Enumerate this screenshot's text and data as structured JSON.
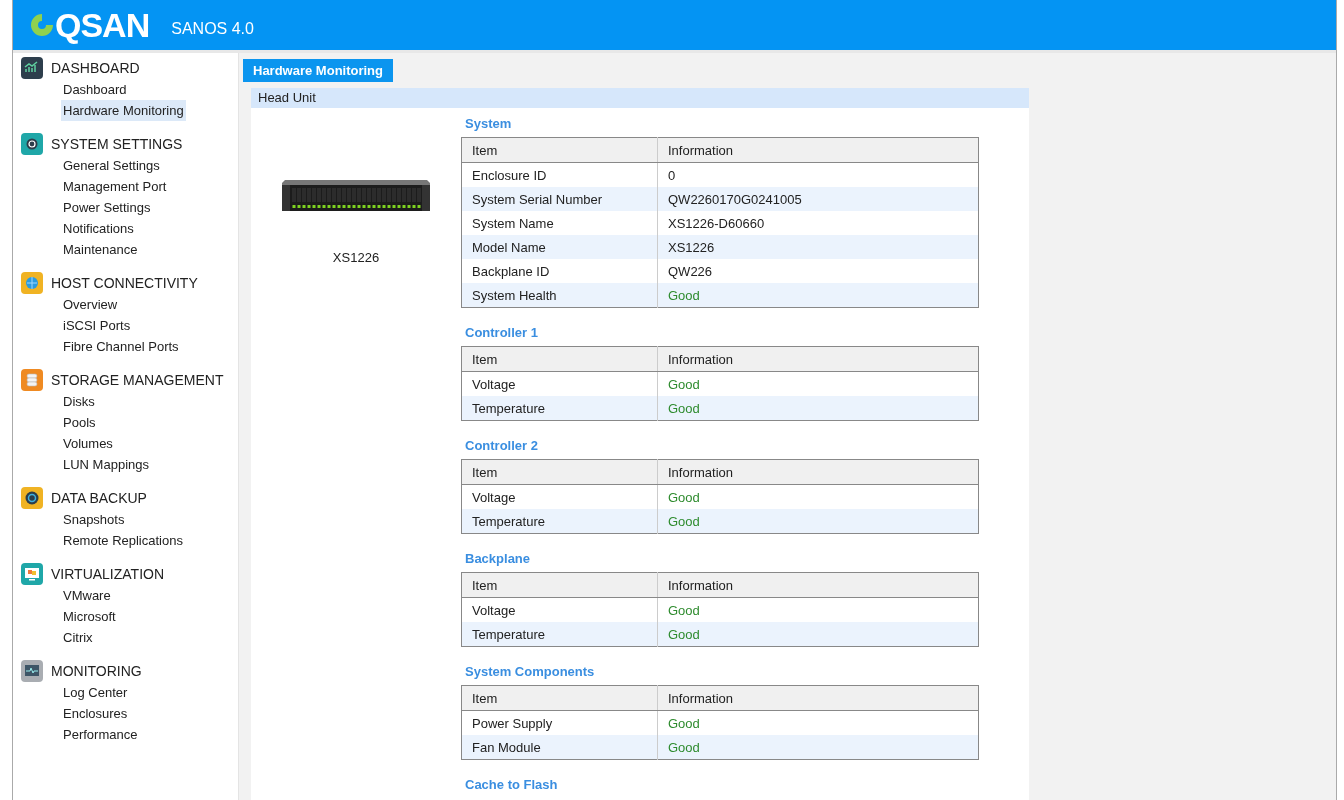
{
  "header": {
    "logo": "QSAN",
    "product": "SANOS 4.0"
  },
  "sidebar": {
    "sections": [
      {
        "kind": "dashboard",
        "title": "DASHBOARD",
        "items": [
          {
            "label": "Dashboard",
            "selected": false
          },
          {
            "label": "Hardware Monitoring",
            "selected": true
          }
        ]
      },
      {
        "kind": "settings",
        "title": "SYSTEM SETTINGS",
        "items": [
          {
            "label": "General Settings",
            "selected": false
          },
          {
            "label": "Management Port",
            "selected": false
          },
          {
            "label": "Power Settings",
            "selected": false
          },
          {
            "label": "Notifications",
            "selected": false
          },
          {
            "label": "Maintenance",
            "selected": false
          }
        ]
      },
      {
        "kind": "host",
        "title": "HOST CONNECTIVITY",
        "items": [
          {
            "label": "Overview",
            "selected": false
          },
          {
            "label": "iSCSI Ports",
            "selected": false
          },
          {
            "label": "Fibre Channel Ports",
            "selected": false
          }
        ]
      },
      {
        "kind": "storage",
        "title": "STORAGE MANAGEMENT",
        "items": [
          {
            "label": "Disks",
            "selected": false
          },
          {
            "label": "Pools",
            "selected": false
          },
          {
            "label": "Volumes",
            "selected": false
          },
          {
            "label": "LUN Mappings",
            "selected": false
          }
        ]
      },
      {
        "kind": "backup",
        "title": "DATA BACKUP",
        "items": [
          {
            "label": "Snapshots",
            "selected": false
          },
          {
            "label": "Remote Replications",
            "selected": false
          }
        ]
      },
      {
        "kind": "virtualization",
        "title": "VIRTUALIZATION",
        "items": [
          {
            "label": "VMware",
            "selected": false
          },
          {
            "label": "Microsoft",
            "selected": false
          },
          {
            "label": "Citrix",
            "selected": false
          }
        ]
      },
      {
        "kind": "monitoring",
        "title": "MONITORING",
        "items": [
          {
            "label": "Log Center",
            "selected": false
          },
          {
            "label": "Enclosures",
            "selected": false
          },
          {
            "label": "Performance",
            "selected": false
          }
        ]
      }
    ]
  },
  "tab": {
    "label": "Hardware Monitoring",
    "selected": true
  },
  "panel": {
    "title": "Head Unit",
    "device": {
      "name": "XS1226"
    },
    "sections": [
      {
        "title": "System",
        "columns": [
          "Item",
          "Information"
        ],
        "rows": [
          {
            "item": "Enclosure ID",
            "info": "0",
            "kind": "text"
          },
          {
            "item": "System Serial Number",
            "info": "QW2260170G0241005",
            "kind": "text"
          },
          {
            "item": "System Name",
            "info": "XS1226-D60660",
            "kind": "text"
          },
          {
            "item": "Model Name",
            "info": "XS1226",
            "kind": "text"
          },
          {
            "item": "Backplane ID",
            "info": "QW226",
            "kind": "text"
          },
          {
            "item": "System Health",
            "info": "Good",
            "kind": "status"
          }
        ]
      },
      {
        "title": "Controller 1",
        "columns": [
          "Item",
          "Information"
        ],
        "rows": [
          {
            "item": "Voltage",
            "info": "Good",
            "kind": "status"
          },
          {
            "item": "Temperature",
            "info": "Good",
            "kind": "status"
          }
        ]
      },
      {
        "title": "Controller 2",
        "columns": [
          "Item",
          "Information"
        ],
        "rows": [
          {
            "item": "Voltage",
            "info": "Good",
            "kind": "status"
          },
          {
            "item": "Temperature",
            "info": "Good",
            "kind": "status"
          }
        ]
      },
      {
        "title": "Backplane",
        "columns": [
          "Item",
          "Information"
        ],
        "rows": [
          {
            "item": "Voltage",
            "info": "Good",
            "kind": "status"
          },
          {
            "item": "Temperature",
            "info": "Good",
            "kind": "status"
          }
        ]
      },
      {
        "title": "System Components",
        "columns": [
          "Item",
          "Information"
        ],
        "rows": [
          {
            "item": "Power Supply",
            "info": "Good",
            "kind": "status"
          },
          {
            "item": "Fan Module",
            "info": "Good",
            "kind": "status"
          }
        ]
      },
      {
        "title": "Cache to Flash"
      }
    ]
  }
}
